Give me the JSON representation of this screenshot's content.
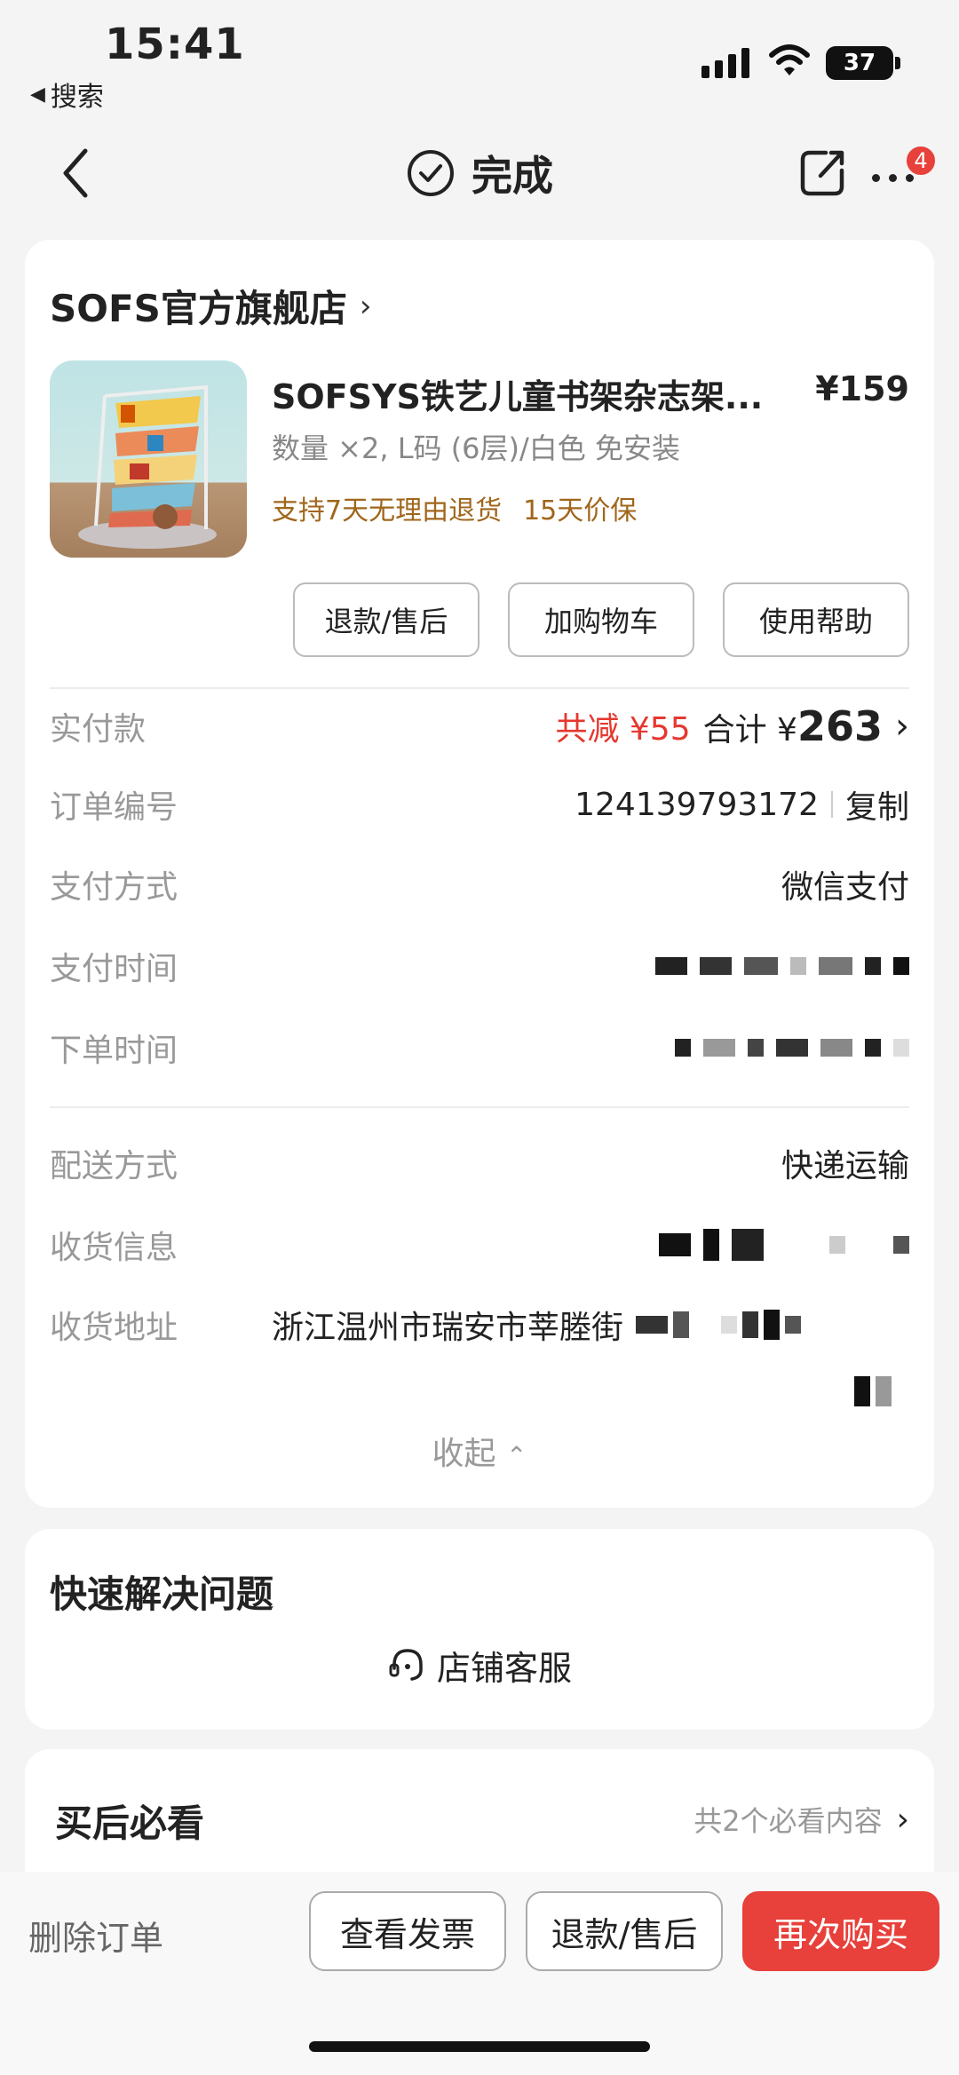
{
  "status_bar": {
    "time": "15:41",
    "back_app": "搜索",
    "battery": "37"
  },
  "nav": {
    "title": "完成",
    "more_badge": "4"
  },
  "order": {
    "shop_name": "SOFS官方旗舰店",
    "product": {
      "name": "SOFSYS铁艺儿童书架杂志架...",
      "price": "¥159",
      "spec": "数量 ×2, L码 (6层)/白色 免安装",
      "guarantee_1": "支持7天无理由退货",
      "guarantee_2": "15天价保"
    },
    "buttons": {
      "refund": "退款/售后",
      "add_cart": "加购物车",
      "help": "使用帮助"
    },
    "paid": {
      "label": "实付款",
      "discount": "共减 ¥55",
      "total_prefix": "合计 ¥",
      "total_value": "263"
    },
    "order_no": {
      "label": "订单编号",
      "value": "124139793172",
      "copy": "复制"
    },
    "pay_method": {
      "label": "支付方式",
      "value": "微信支付"
    },
    "pay_time": {
      "label": "支付时间"
    },
    "order_time": {
      "label": "下单时间"
    },
    "delivery": {
      "label": "配送方式",
      "value": "快递运输"
    },
    "receiver": {
      "label": "收货信息"
    },
    "address": {
      "label": "收货地址",
      "value": "浙江温州市瑞安市莘塍街"
    },
    "collapse": "收起"
  },
  "quick_help": {
    "title": "快速解决问题",
    "service": "店铺客服"
  },
  "after_sale": {
    "title": "买后必看",
    "more": "共2个必看内容"
  },
  "bottom_bar": {
    "delete": "删除订单",
    "invoice": "查看发票",
    "refund": "退款/售后",
    "rebuy": "再次购买"
  }
}
